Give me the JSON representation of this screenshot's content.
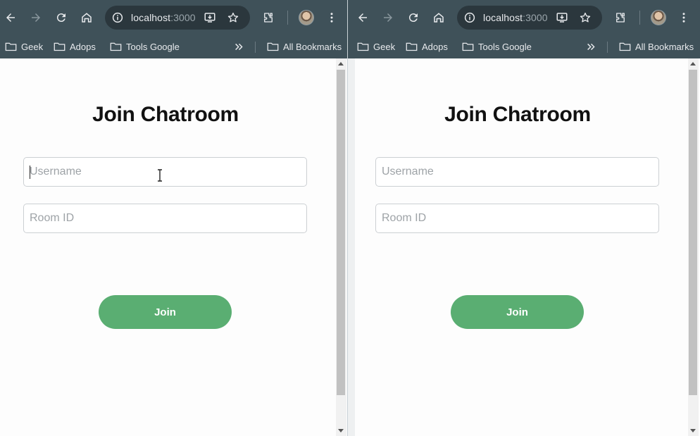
{
  "browser": {
    "url_host": "localhost",
    "url_port": ":3000",
    "bookmarks": [
      "Geek",
      "Adops",
      "Tools Google"
    ],
    "all_bookmarks_label": "All Bookmarks"
  },
  "page": {
    "title": "Join Chatroom",
    "username_placeholder": "Username",
    "room_placeholder": "Room ID",
    "join_label": "Join"
  },
  "colors": {
    "chrome": "#3f5159",
    "join_button": "#5aae72"
  },
  "icons": [
    "back-icon",
    "forward-icon",
    "reload-icon",
    "home-icon",
    "site-info-icon",
    "install-app-icon",
    "star-icon",
    "extensions-icon",
    "menu-icon",
    "folder-icon",
    "chevron-double-right-icon"
  ]
}
